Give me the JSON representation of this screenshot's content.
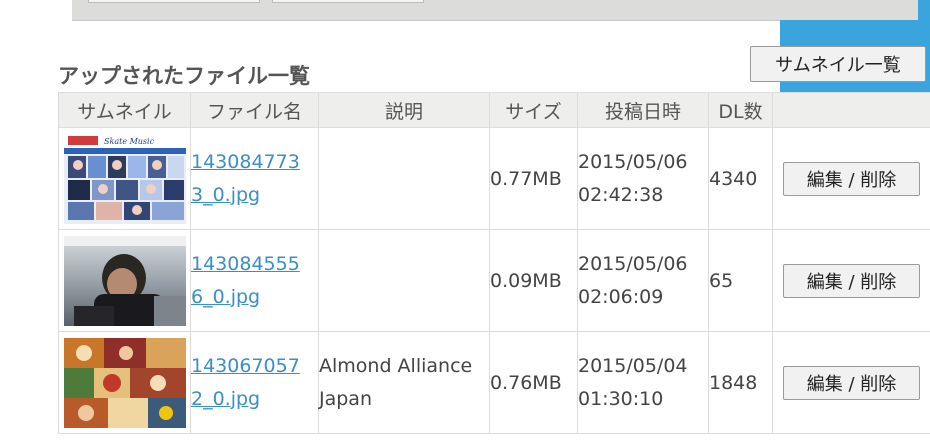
{
  "section": {
    "title": "アップされたファイル一覧",
    "thumbnail_list_button": "サムネイル一覧"
  },
  "table": {
    "headers": [
      "サムネイル",
      "ファイル名",
      "説明",
      "サイズ",
      "投稿日時",
      "DL数",
      ""
    ],
    "rows": [
      {
        "thumbnail": "poster-collage-thumbnail",
        "file_name": "1430847733_0.jpg",
        "description": "",
        "size": "0.77MB",
        "date": "2015/05/06",
        "time": "02:42:38",
        "downloads": "4340",
        "action": "編集 / 削除"
      },
      {
        "thumbnail": "person-rink-thumbnail",
        "file_name": "1430845556_0.jpg",
        "description": "",
        "size": "0.09MB",
        "date": "2015/05/06",
        "time": "02:06:09",
        "downloads": "65",
        "action": "編集 / 削除"
      },
      {
        "thumbnail": "food-collage-thumbnail",
        "file_name": "1430670572_0.jpg",
        "description": "Almond Alliance Japan",
        "size": "0.76MB",
        "date": "2015/05/04",
        "time": "01:30:10",
        "downloads": "1848",
        "action": "編集 / 削除"
      }
    ]
  },
  "colors": {
    "accent_blue": "#3aa4dc",
    "link": "#3a8fc7",
    "header_bg": "#eeefed",
    "top_panel": "#dcdddb"
  }
}
